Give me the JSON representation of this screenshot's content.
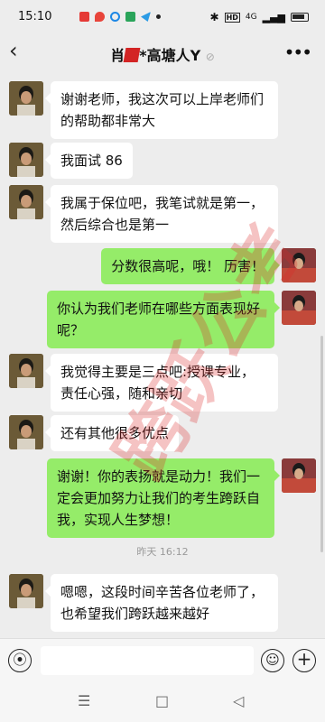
{
  "status_bar": {
    "time": "15:10",
    "right_text": "4G"
  },
  "header": {
    "back_label": "‹",
    "title": "肖",
    "title_suffix": "*高塘人Y",
    "more_label": "•••"
  },
  "messages": [
    {
      "side": "left",
      "text": "谢谢老师，我这次可以上岸老师们的帮助都非常大"
    },
    {
      "side": "left",
      "text": "我面试 86"
    },
    {
      "side": "left",
      "text": "我属于保位吧，我笔试就是第一，然后综合也是第一"
    },
    {
      "side": "right",
      "text": "分数很高呢，哦！ 历害！"
    },
    {
      "side": "right",
      "text": "你认为我们老师在哪些方面表现好呢？"
    },
    {
      "side": "left",
      "text": "我觉得主要是三点吧:授课专业，责任心强，随和亲切"
    },
    {
      "side": "left",
      "text": "还有其他很多优点"
    },
    {
      "side": "right",
      "text": "谢谢！你的表扬就是动力！我们一定会更加努力让我们的考生跨跃自我，实现人生梦想！"
    },
    {
      "side": "left",
      "text": "嗯嗯，这段时间辛苦各位老师了，也希望我们跨跃越来越好"
    }
  ],
  "timestamp": "昨天 16:12",
  "watermark": "跨跃公考",
  "input_bar": {
    "value": "",
    "voice_icon": "voice-icon",
    "emoji_icon": "emoji-icon",
    "plus_icon": "plus-icon"
  },
  "nav": {
    "menu_label": "☰",
    "home_label": "□",
    "back_label": "◁"
  },
  "colors": {
    "sent_bubble": "#95ec69",
    "received_bubble": "#ffffff",
    "background": "#ededed"
  }
}
